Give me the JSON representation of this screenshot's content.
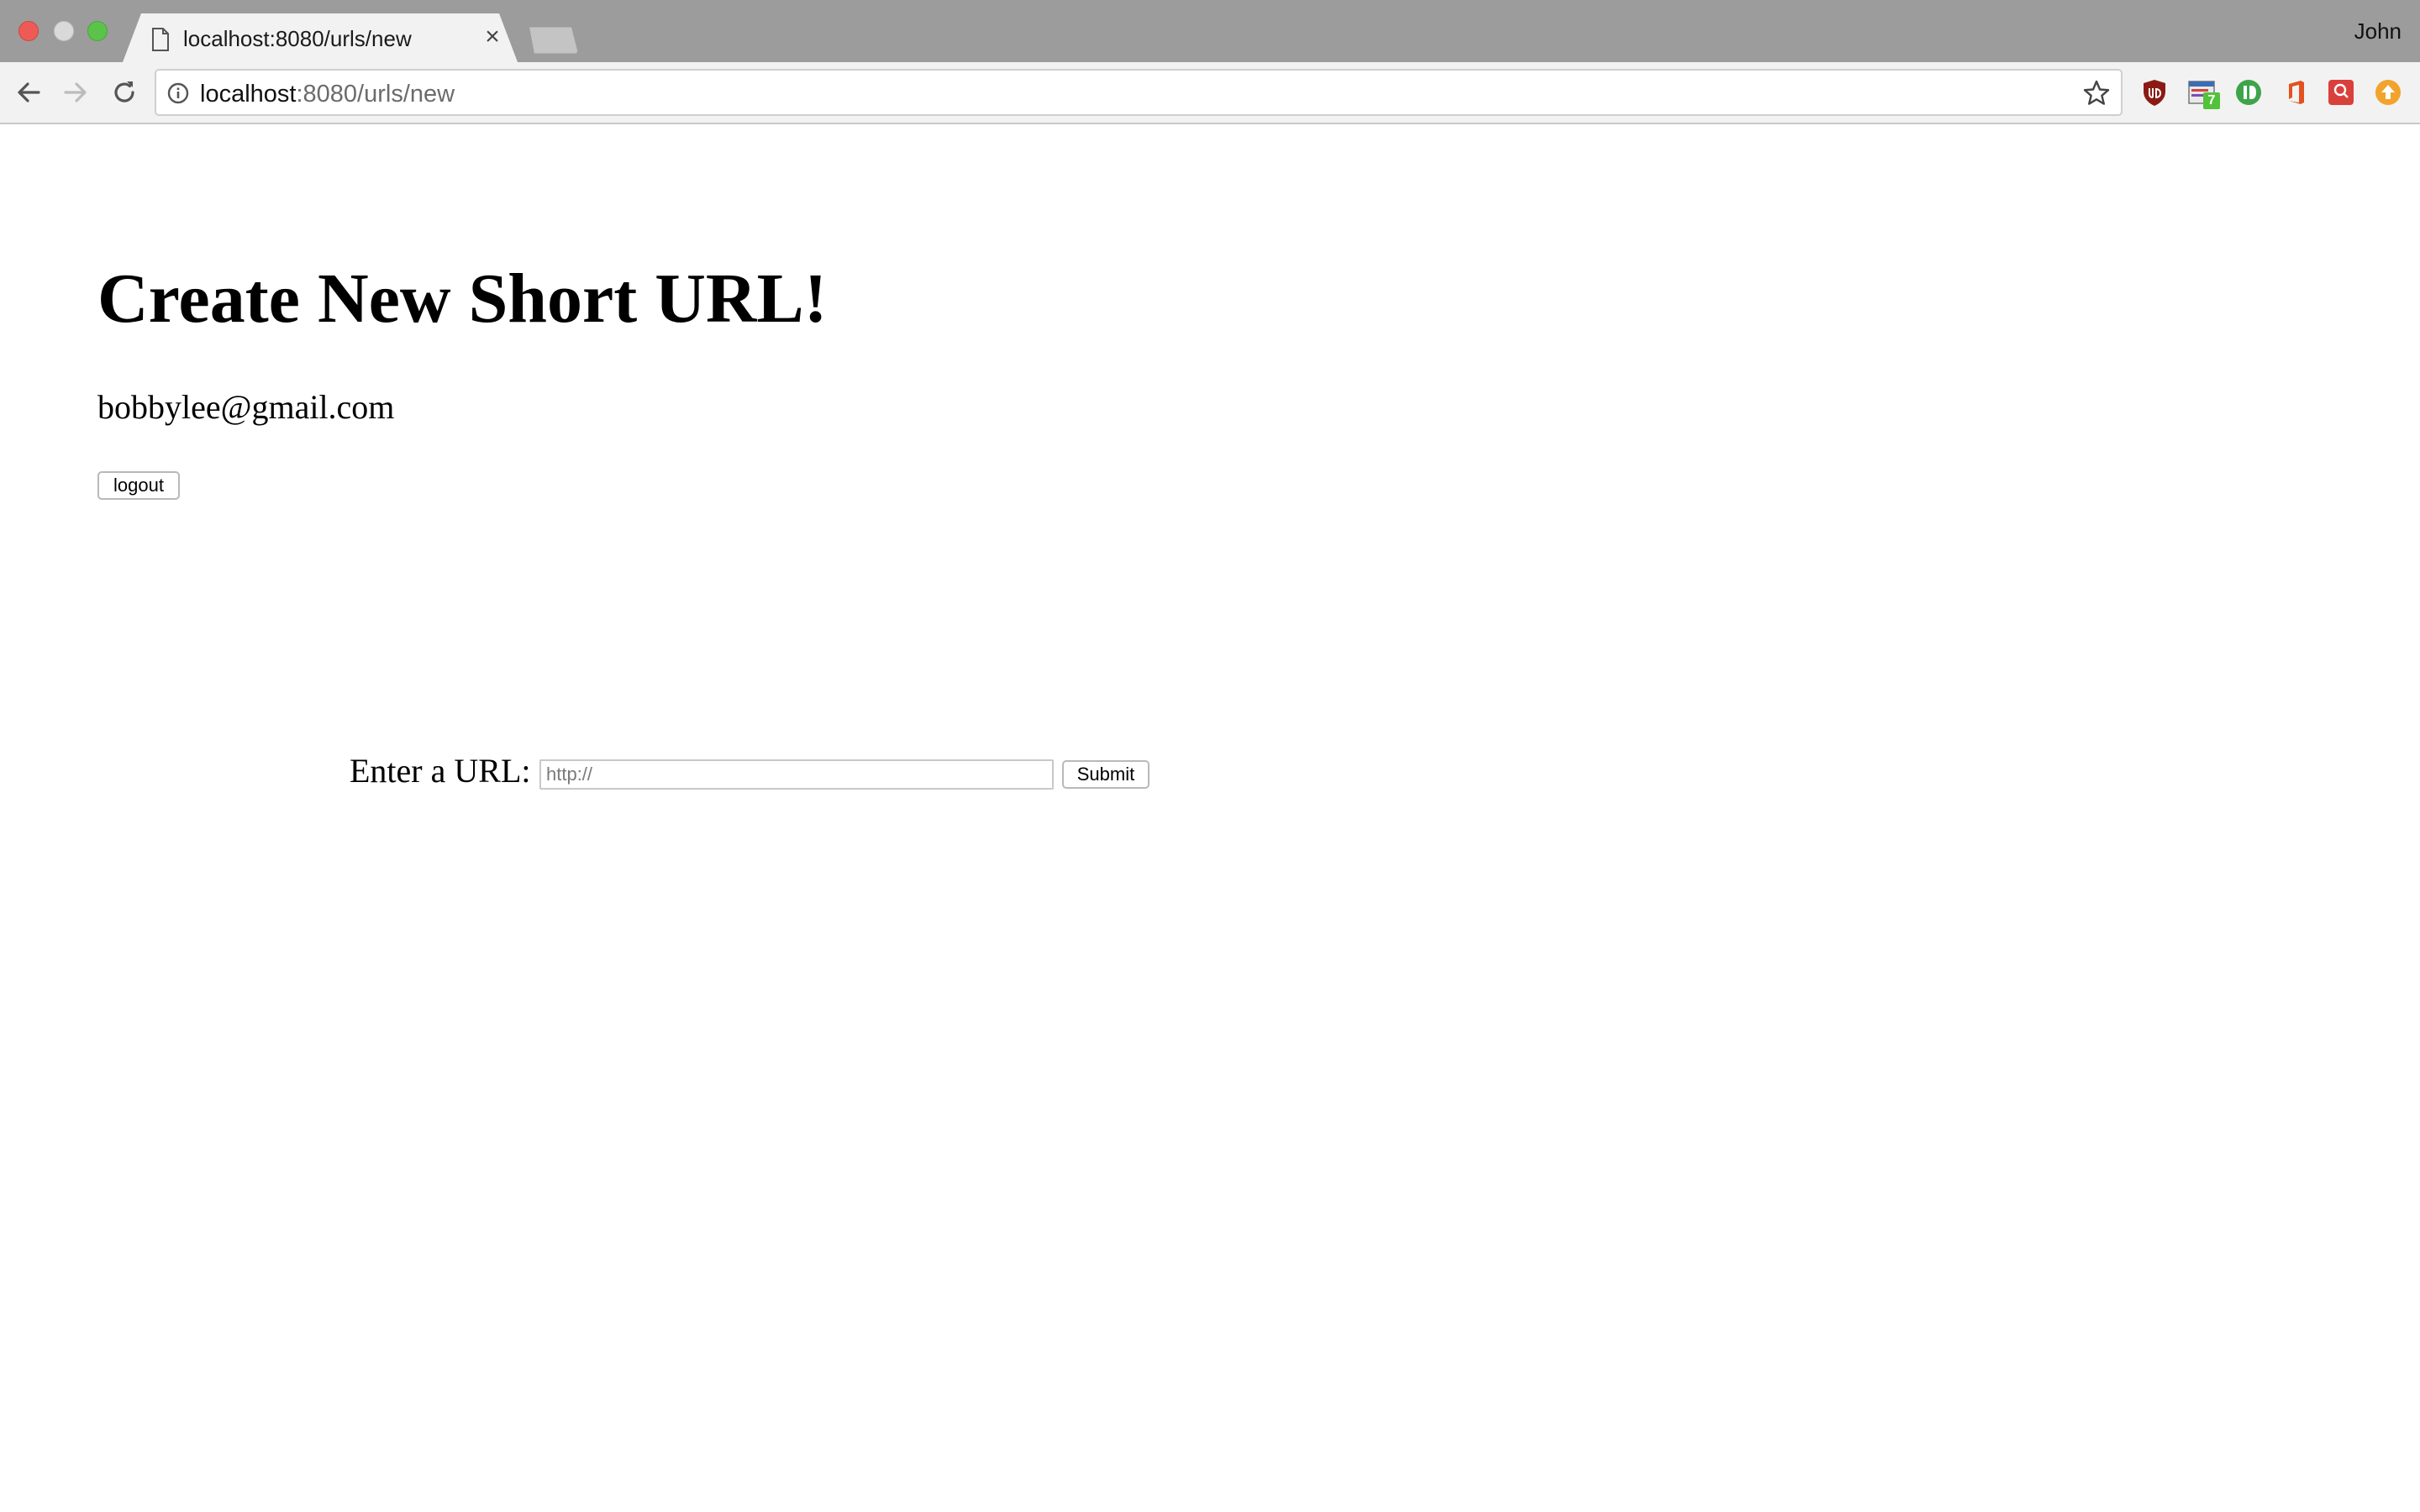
{
  "browser": {
    "tab": {
      "title": "localhost:8080/urls/new",
      "close_glyph": "×",
      "icon": "page-icon"
    },
    "profile_name": "John",
    "address_bar": {
      "host": "localhost",
      "rest": ":8080/urls/new"
    },
    "extensions": [
      {
        "name": "ublock-icon",
        "color": "#8b1a14"
      },
      {
        "name": "calendar-extension-icon",
        "color": "#3b6db3",
        "badge": "7"
      },
      {
        "name": "green-extension-icon",
        "color": "#3da44a"
      },
      {
        "name": "office-icon",
        "color": "#e2511f"
      },
      {
        "name": "red-extension-icon",
        "color": "#d9403b"
      },
      {
        "name": "orange-extension-icon",
        "color": "#f2a32b"
      }
    ],
    "colors": {
      "tab_strip": "#9c9c9c",
      "toolbar": "#f2f2f2"
    }
  },
  "page": {
    "title": "Create New Short URL!",
    "user_email": "bobbylee@gmail.com",
    "logout_label": "logout",
    "form": {
      "label": "Enter a URL:",
      "input_placeholder": "http://",
      "input_value": "",
      "submit_label": "Submit"
    }
  }
}
